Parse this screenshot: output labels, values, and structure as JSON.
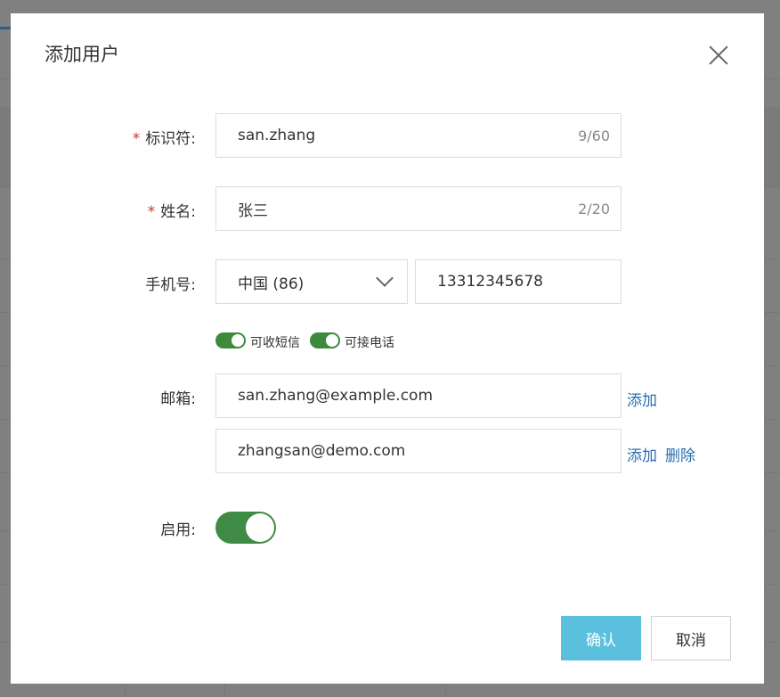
{
  "modal": {
    "title": "添加用户"
  },
  "form": {
    "identifier": {
      "label": "标识符:",
      "required_mark": "*",
      "value": "san.zhang",
      "count": "9/60"
    },
    "name": {
      "label": "姓名:",
      "required_mark": "*",
      "value": "张三",
      "count": "2/20"
    },
    "phone": {
      "label": "手机号:",
      "country_code": "中国 (86)",
      "number": "13312345678",
      "sms_toggle_label": "可收短信",
      "call_toggle_label": "可接电话"
    },
    "email": {
      "label": "邮箱:",
      "values": [
        "san.zhang@example.com",
        "zhangsan@demo.com"
      ],
      "add_label": "添加",
      "delete_label": "删除"
    },
    "enabled": {
      "label": "启用:",
      "state": "on"
    }
  },
  "footer": {
    "confirm_label": "确认",
    "cancel_label": "取消"
  },
  "colors": {
    "toggle_on": "#3f8a45",
    "primary": "#5bc0de",
    "link": "#2b6cb0",
    "required": "#c0392b"
  }
}
